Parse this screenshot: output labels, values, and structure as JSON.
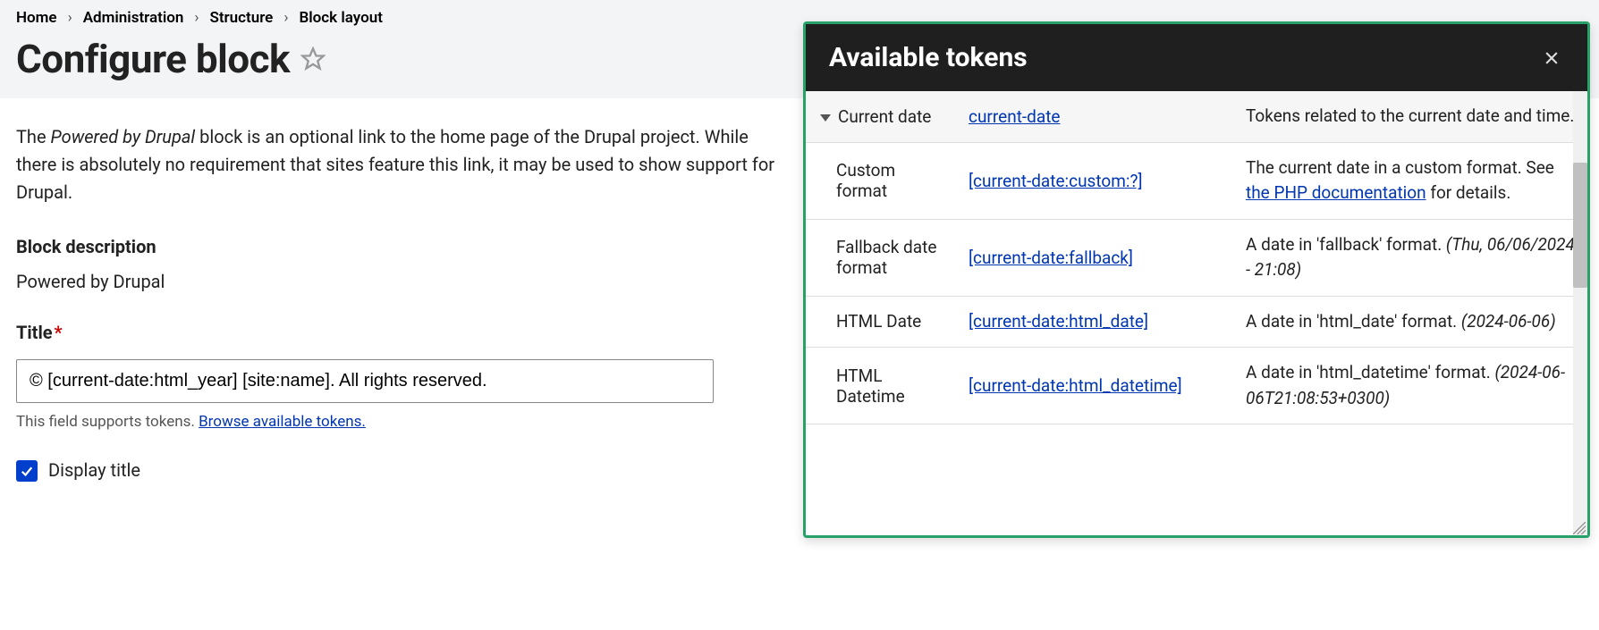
{
  "breadcrumb": {
    "home": "Home",
    "administration": "Administration",
    "structure": "Structure",
    "block_layout": "Block layout"
  },
  "page_title": "Configure block",
  "intro": {
    "prefix": "The ",
    "em": "Powered by Drupal",
    "suffix": " block is an optional link to the home page of the Drupal project. While there is absolutely no requirement that sites feature this link, it may be used to show support for Drupal."
  },
  "block_description_label": "Block description",
  "block_description_value": "Powered by Drupal",
  "title_label": "Title",
  "title_value": "© [current-date:html_year] [site:name]. All rights reserved.",
  "help_text_prefix": "This field supports tokens. ",
  "help_text_link": "Browse available tokens.",
  "display_title_label": "Display title",
  "dialog": {
    "title": "Available tokens",
    "rows": [
      {
        "group": true,
        "name": "Current date",
        "token": "current-date",
        "desc": "Tokens related to the current date and time."
      },
      {
        "name": "Custom format",
        "token": "[current-date:custom:?]",
        "desc_pre": "The current date in a custom format. See ",
        "desc_link": "the PHP documentation",
        "desc_post": " for details."
      },
      {
        "name": "Fallback date format",
        "token": "[current-date:fallback]",
        "desc": "A date in 'fallback' format. ",
        "example": "(Thu, 06/06/2024 - 21:08)"
      },
      {
        "name": "HTML Date",
        "token": "[current-date:html_date]",
        "desc": "A date in 'html_date' format. ",
        "example": "(2024-06-06)"
      },
      {
        "name": "HTML Datetime",
        "token": "[current-date:html_datetime]",
        "desc": "A date in 'html_datetime' format. ",
        "example": "(2024-06-06T21:08:53+0300)"
      }
    ]
  }
}
